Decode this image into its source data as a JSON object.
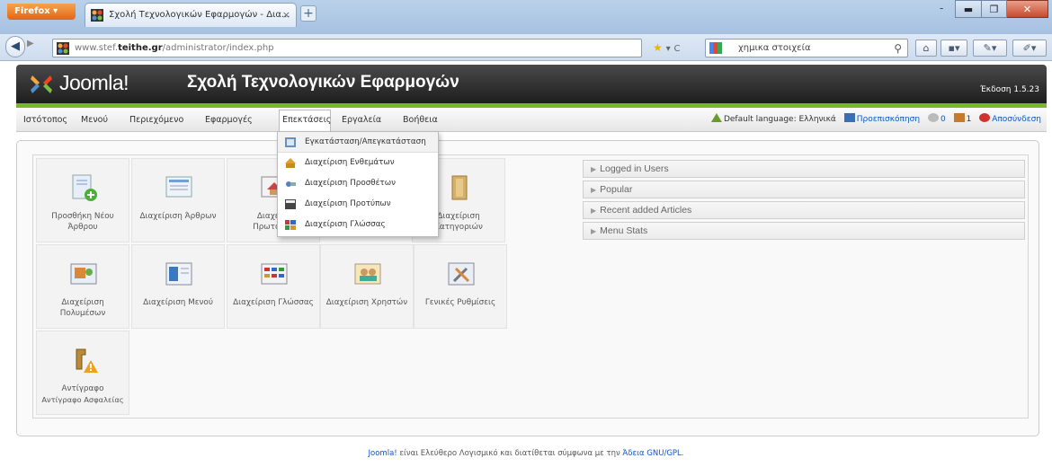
{
  "browser": {
    "app_button": "Firefox",
    "tab_title": "Σχολή Τεχνολογικών Εφαρμογών - Δια...",
    "url_domain_prefix": "www.stef.",
    "url_domain": "teithe.gr",
    "url_path": "/administrator/index.php",
    "search_text": "χημικα στοιχεία"
  },
  "header": {
    "logo_text": "Joomla!",
    "site_name": "Σχολή Τεχνολογικών Εφαρμογών",
    "version": "Έκδοση 1.5.23"
  },
  "menu": {
    "items": [
      "Ιστότοπος",
      "Μενού",
      "Περιεχόμενο",
      "Εφαρμογές",
      "Επεκτάσεις",
      "Εργαλεία",
      "Βοήθεια"
    ],
    "active": "Επεκτάσεις"
  },
  "status": {
    "language": "Default language: Ελληνικά",
    "preview": "Προεπισκόπηση",
    "messages_count": "0",
    "users_count": "1",
    "logout": "Αποσύνδεση"
  },
  "dropdown": {
    "items": [
      "Εγκατάσταση/Απεγκατάσταση",
      "Διαχείριση Ενθεμάτων",
      "Διαχείριση Προσθέτων",
      "Διαχείριση Προτύπων",
      "Διαχείριση Γλώσσας"
    ]
  },
  "cpanel": {
    "tiles": [
      {
        "line1": "Προσθήκη Νέου",
        "line2": "Άρθρου",
        "icon": "add-article-icon"
      },
      {
        "line1": "Διαχείριση Άρθρων",
        "line2": "",
        "icon": "articles-icon"
      },
      {
        "line1": "Διαχείρι",
        "line2": "Πρωτοσέλ",
        "icon": "frontpage-icon"
      },
      {
        "line1": "Διαχείριση",
        "line2": "Κατηγοριών",
        "icon": "categories-icon"
      },
      {
        "line1": "Διαχείριση",
        "line2": "Πολυμέσων",
        "icon": "media-icon"
      },
      {
        "line1": "Διαχείριση Μενού",
        "line2": "",
        "icon": "menu-icon"
      },
      {
        "line1": "Διαχείριση Γλώσσας",
        "line2": "",
        "icon": "language-icon"
      },
      {
        "line1": "Διαχείριση Χρηστών",
        "line2": "",
        "icon": "users-icon"
      },
      {
        "line1": "Γενικές Ρυθμίσεις",
        "line2": "",
        "icon": "config-icon"
      },
      {
        "line1": "Αντίγραφο",
        "line2": "Αντίγραφο Ασφαλείας",
        "icon": "backup-icon"
      }
    ]
  },
  "panels": [
    "Logged in Users",
    "Popular",
    "Recent added Articles",
    "Menu Stats"
  ],
  "footer": {
    "link": "Joomla!",
    "text": " είναι Ελεύθερο Λογισμικό και διατίθεται σύμφωνα με την ",
    "license": "Άδεια GNU/GPL",
    "end": "."
  },
  "colors": {
    "accent_green": "#76b82a",
    "link_blue": "#0b55c4"
  }
}
